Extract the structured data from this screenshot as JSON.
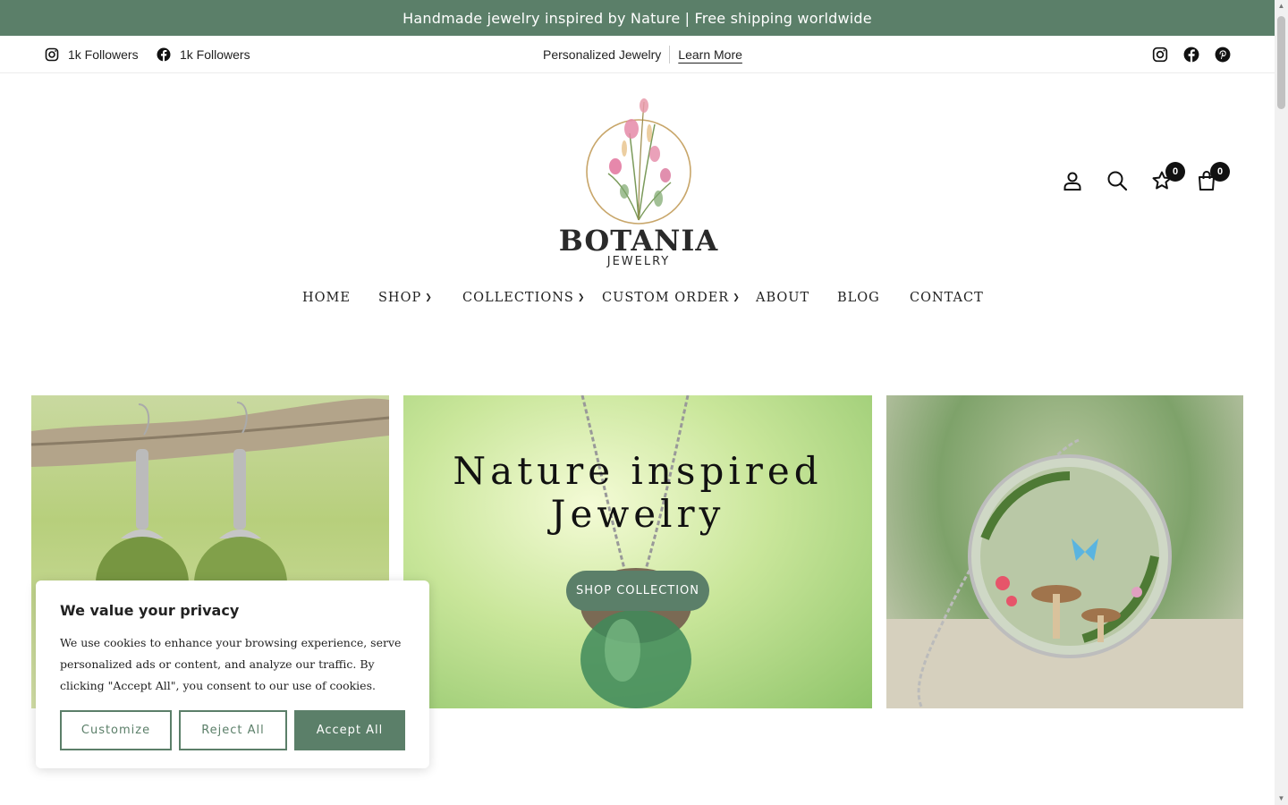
{
  "announcement": "Handmade jewelry inspired by Nature | Free shipping worldwide",
  "topbar": {
    "instagram_followers": "1k Followers",
    "facebook_followers": "1k Followers",
    "personalized": "Personalized Jewelry",
    "learn_more": "Learn More"
  },
  "brand": {
    "name": "BOTANIA",
    "sub": "JEWELRY"
  },
  "header": {
    "wishlist_count": "0",
    "cart_count": "0"
  },
  "nav": [
    {
      "label": "HOME"
    },
    {
      "label": "SHOP"
    },
    {
      "label": "COLLECTIONS"
    },
    {
      "label": "CUSTOM ORDER"
    },
    {
      "label": "ABOUT"
    },
    {
      "label": "BLOG"
    },
    {
      "label": "CONTACT"
    }
  ],
  "hero": {
    "title_line1": "Nature inspired",
    "title_line2": "Jewelry",
    "button": "SHOP COLLECTION"
  },
  "cookie": {
    "title": "We value your privacy",
    "body": "We use cookies to enhance your browsing experience, serve personalized ads or content, and analyze our traffic. By clicking \"Accept All\", you consent to our use of cookies.",
    "customize": "Customize",
    "reject": "Reject All",
    "accept": "Accept All"
  },
  "colors": {
    "accent": "#5b7f69"
  }
}
